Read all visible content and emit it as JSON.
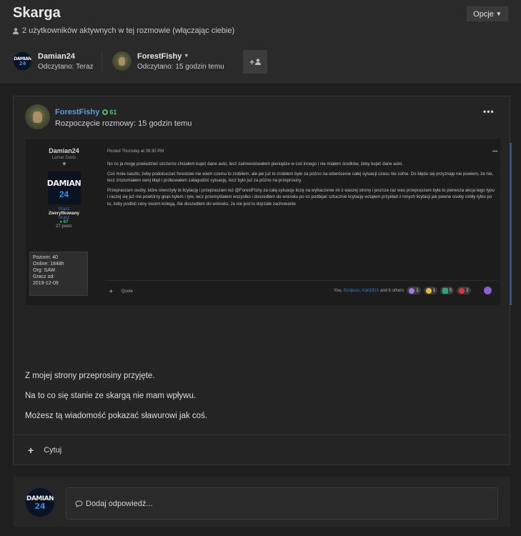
{
  "header": {
    "title": "Skarga",
    "options_label": "Opcje",
    "active_users": "2 użytkowników aktywnych w tej rozmowie (włączając ciebie)",
    "participants": [
      {
        "name": "Damian24",
        "read": "Odczytano: Teraz"
      },
      {
        "name": "ForestFishy",
        "read": "Odczytano: 15 godzin temu"
      }
    ]
  },
  "avatar_text": {
    "line1": "DAMIAN",
    "line2": "24"
  },
  "post": {
    "author": "ForestFishy",
    "reputation": "61",
    "started": "Rozpoczęcie rozmowy: 15 godzin temu",
    "screenshot": {
      "name": "Damian24",
      "subtitle": "Lamar Davis",
      "rank1": "Gracz",
      "rank2": "Zweryfikowany",
      "rank3": "Gracz",
      "rep": "67",
      "posts": "27 posts",
      "stats": [
        "Poziom: 40",
        "Online: 1848h",
        "Org: SAW",
        "Gracz od:",
        "2019-12-09"
      ],
      "posted": "Posted Thursday at 08:30 PM",
      "paragraphs": [
        "No co ja mogę powiedzieć szczerze chciałem kupić dane auto, lecz zainwestowałem pieniądze w coś innego i nie miałem środków, żeby kupić dane auto.",
        "Coś mnie naszło, żeby podokuczać forestowi nie wiem czemu to zrobiłem, ale jak już to zrobiłem było za późno na odwrócenie całej sytuacji czasu nie cofne. Do błędu się przyznaję nie powiem, że nie, lecz zrozumiałem swój błąd i próbowałem załagodzić sytuację, lecz było już za późno na przeprosiny.",
        "Przepraszam osoby, które stworzyły te licytację i przepraszam też @ForestFishy za całą sytuację liczę na wybaczenie mi z waszej strony i jeszcze raz was przepraszam była to pierwsza akcja tego typu i raczej się już nie powtórzy głupi byłem i tyle, lecz przemyślałem wszystko i doszedłem do wniosku po co podbijać sztucznie licytację wziąłem przykład z innych licytacji jak pewne osoby robiły tylko po to, żeby podbić ceny swoim kolegą. Ale doszedłem do wniosku, że nie jest to dojrzałe zachowanie"
      ],
      "quote": "Quote",
      "reactors": {
        "you": "You,",
        "user1": "Szopuss,",
        "user2": "Kali1821",
        "rest": "and 6 others"
      },
      "reactions": [
        {
          "count": "1",
          "color": "#9b7be0"
        },
        {
          "count": "1",
          "color": "#e9b93a"
        },
        {
          "count": "5",
          "color": "#2fa37d"
        },
        {
          "count": "2",
          "color": "#d9363e"
        }
      ]
    },
    "messages": [
      "Z mojej strony przeprosiny przyjęte.",
      "Na to co się stanie ze skargą nie mam wpływu.",
      "Możesz tą wiadomość pokazać sławurowi jak coś."
    ],
    "quote_label": "Cytuj"
  },
  "reply": {
    "placeholder": "Dodaj odpowiedź..."
  }
}
